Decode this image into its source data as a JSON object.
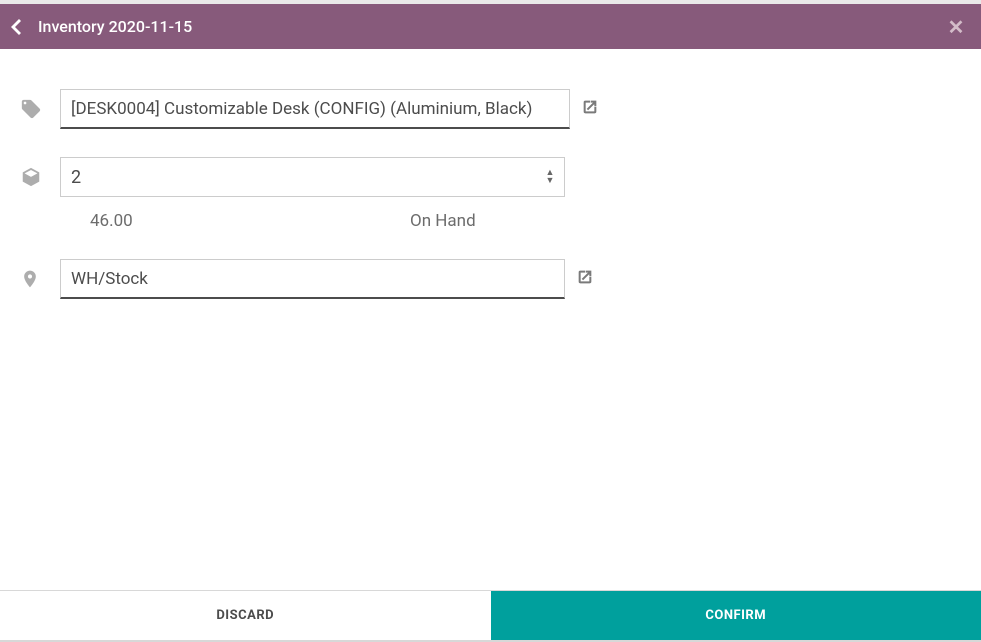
{
  "header": {
    "title": "Inventory 2020-11-15"
  },
  "product": {
    "value": "[DESK0004] Customizable Desk (CONFIG) (Aluminium, Black)"
  },
  "quantity": {
    "value": "2",
    "on_hand_value": "46.00",
    "on_hand_label": "On Hand"
  },
  "location": {
    "value": "WH/Stock"
  },
  "footer": {
    "discard_label": "DISCARD",
    "confirm_label": "CONFIRM"
  }
}
